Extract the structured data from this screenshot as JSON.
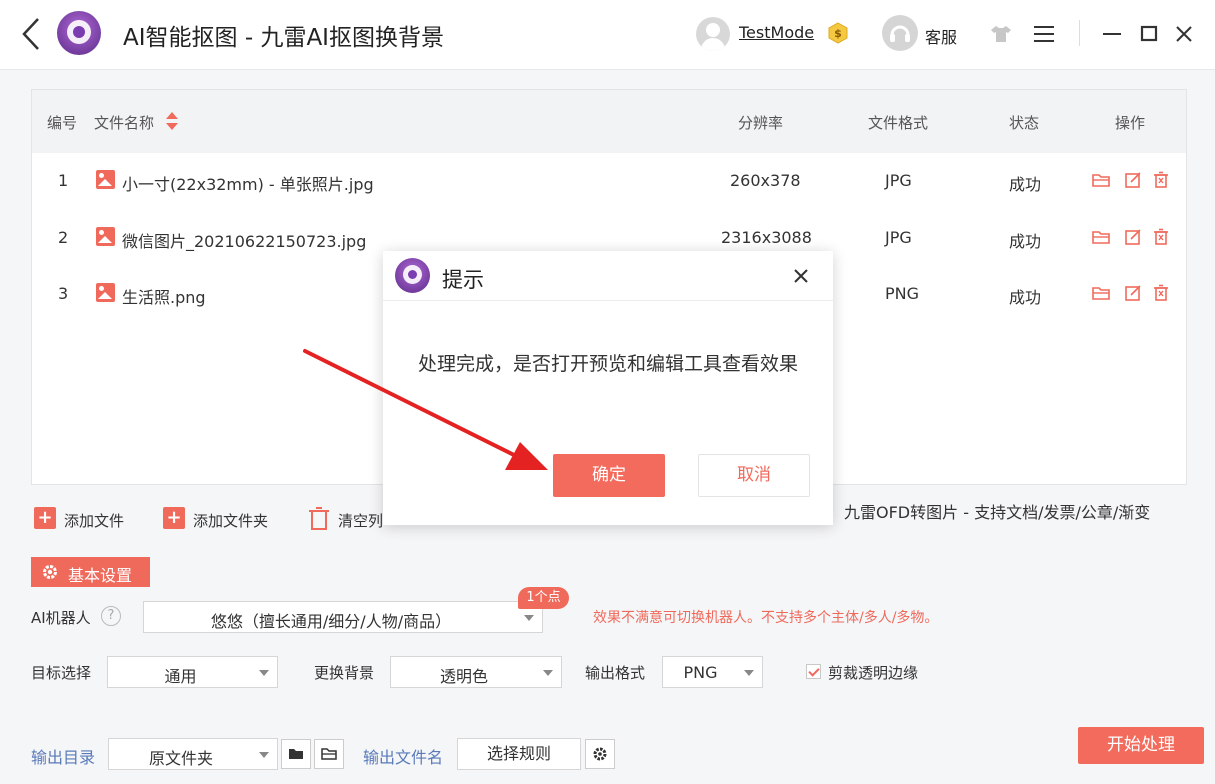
{
  "app": {
    "title": "AI智能抠图 - 九雷AI抠图换背景",
    "username": "TestMode",
    "service_label": "客服"
  },
  "table": {
    "headers": {
      "index": "编号",
      "filename": "文件名称",
      "resolution": "分辨率",
      "format": "文件格式",
      "status": "状态",
      "actions": "操作"
    },
    "rows": [
      {
        "index": "1",
        "filename": "小一寸(22x32mm) - 单张照片.jpg",
        "resolution": "260x378",
        "format": "JPG",
        "status": "成功"
      },
      {
        "index": "2",
        "filename": "微信图片_20210622150723.jpg",
        "resolution": "2316x3088",
        "format": "JPG",
        "status": "成功"
      },
      {
        "index": "3",
        "filename": "生活照.png",
        "resolution": "",
        "format": "PNG",
        "status": "成功"
      }
    ]
  },
  "toolbar": {
    "add_file": "添加文件",
    "add_folder": "添加文件夹",
    "clear_list": "清空列",
    "ofd_promo": "九雷OFD转图片 - 支持文档/发票/公章/渐变"
  },
  "settings": {
    "section_label": "基本设置",
    "robot_label": "AI机器人",
    "help_glyph": "?",
    "robot_value": "悠悠（擅长通用/细分/人物/商品）",
    "points_badge": "1个点",
    "robot_hint": "效果不满意可切换机器人。不支持多个主体/多人/多物。",
    "target_label": "目标选择",
    "target_value": "通用",
    "background_label": "更换背景",
    "background_value": "透明色",
    "output_format_label": "输出格式",
    "output_format_value": "PNG",
    "trim_label": "剪裁透明边缘",
    "output_dir_label": "输出目录",
    "output_dir_value": "原文件夹",
    "output_name_label": "输出文件名",
    "rule_button": "选择规则",
    "start_button": "开始处理"
  },
  "modal": {
    "title": "提示",
    "message": "处理完成，是否打开预览和编辑工具查看效果",
    "ok_button": "确定",
    "cancel_button": "取消"
  },
  "colors": {
    "accent": "#f26b5d",
    "link_blue": "#5a7ab8",
    "annotation_arrow": "#e52222"
  }
}
